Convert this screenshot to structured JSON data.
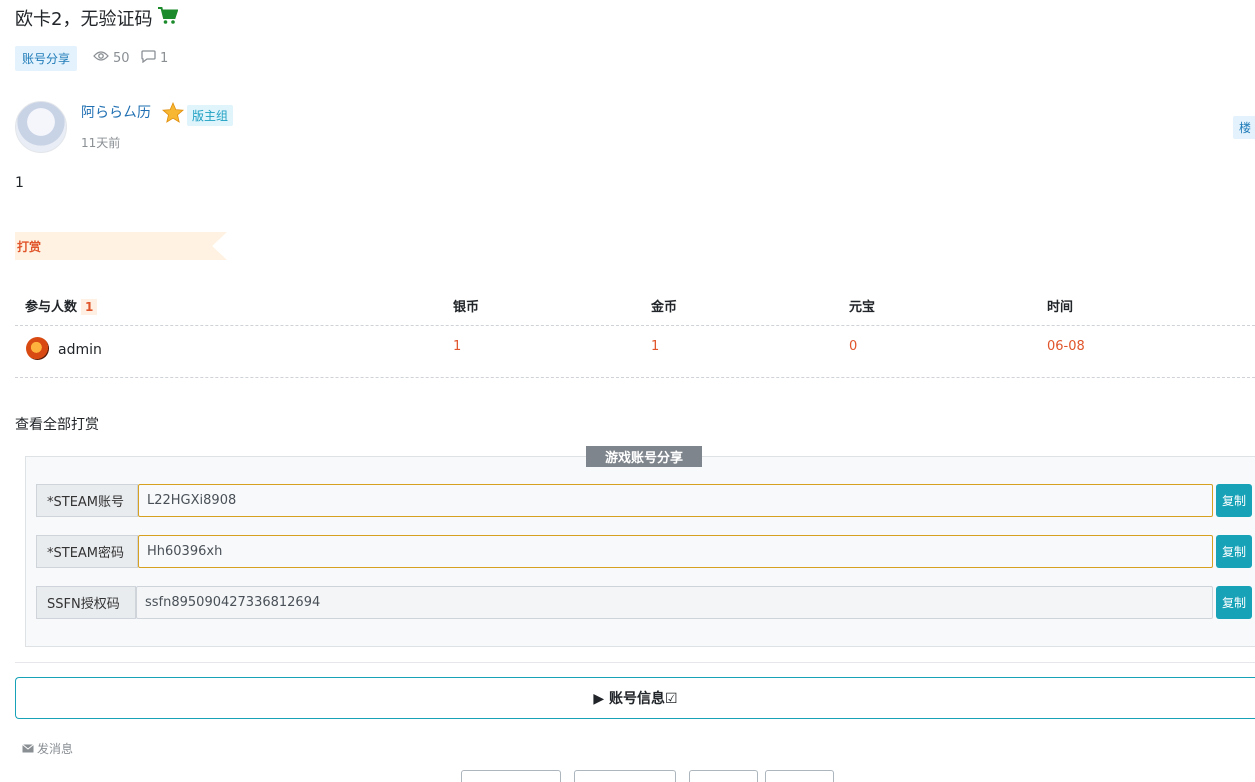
{
  "post": {
    "title": "欧卡2，无验证码",
    "title_icon": "cart-icon",
    "category": "账号分享",
    "views": "50",
    "comments": "1",
    "author": "阿ららㄙ历",
    "role": "版主组",
    "time": "11天前",
    "floor": "楼",
    "content": "1"
  },
  "reward": {
    "label": "打赏",
    "headers": {
      "participants": "参与人数",
      "count": "1",
      "silver": "银币",
      "gold": "金币",
      "ingot": "元宝",
      "time": "时间"
    },
    "rows": [
      {
        "user": "admin",
        "silver": "1",
        "gold": "1",
        "ingot": "0",
        "time": "06-08"
      }
    ],
    "view_all": "查看全部打赏"
  },
  "account": {
    "legend": "游戏账号分享",
    "fields": [
      {
        "label": "*STEAM账号",
        "value": "L22HGXi8908",
        "copy": "复制"
      },
      {
        "label": "*STEAM密码",
        "value": "Hh60396xh",
        "copy": "复制"
      },
      {
        "label": "SSFN授权码",
        "value": "ssfn895090427336812694",
        "copy": "复制"
      }
    ],
    "info_toggle": "▶ 账号信息☑"
  },
  "footer": {
    "send_message": "发消息"
  },
  "colors": {
    "accent": "#17a2b8",
    "reward": "#e0552b",
    "link": "#1f6fb2"
  }
}
